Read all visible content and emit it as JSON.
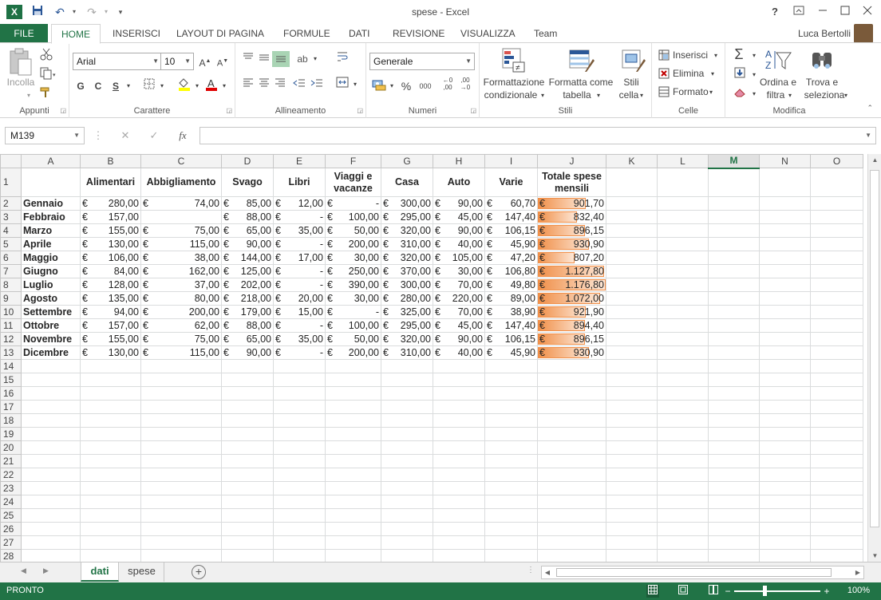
{
  "window": {
    "title": "spese - Excel",
    "help": "?",
    "user_name": "Luca Bertolli"
  },
  "quick_access": {
    "save": "💾",
    "undo": "↶",
    "redo": "↷",
    "customize": "▾"
  },
  "ribbon_tabs": {
    "file": "FILE",
    "home": "HOME",
    "insert": "INSERISCI",
    "page_layout": "LAYOUT DI PAGINA",
    "formulas": "FORMULE",
    "data": "DATI",
    "review": "REVISIONE",
    "view": "VISUALIZZA",
    "team": "Team"
  },
  "ribbon": {
    "clipboard": {
      "paste": "Incolla",
      "group": "Appunti"
    },
    "font": {
      "name": "Arial",
      "size": "10",
      "bold": "G",
      "italic": "C",
      "underline": "S",
      "group": "Carattere"
    },
    "alignment": {
      "group": "Allineamento"
    },
    "number": {
      "format": "Generale",
      "percent": "%",
      "thousands": "000",
      "group": "Numeri"
    },
    "styles": {
      "cond_format_1": "Formattazione",
      "cond_format_2": "condizionale",
      "table_format_1": "Formatta come",
      "table_format_2": "tabella",
      "cell_styles_1": "Stili",
      "cell_styles_2": "cella",
      "group": "Stili"
    },
    "cells": {
      "insert": "Inserisci",
      "delete": "Elimina",
      "format": "Formato",
      "group": "Celle"
    },
    "editing": {
      "sort_1": "Ordina e",
      "sort_2": "filtra",
      "find_1": "Trova e",
      "find_2": "seleziona",
      "group": "Modifica"
    }
  },
  "formula_bar": {
    "name_box": "M139",
    "cancel": "✕",
    "confirm": "✓",
    "fx": "fx",
    "formula": ""
  },
  "sheet": {
    "columns": [
      "A",
      "B",
      "C",
      "D",
      "E",
      "F",
      "G",
      "H",
      "I",
      "J",
      "K",
      "L",
      "M",
      "N",
      "O"
    ],
    "selected_column": "M",
    "row_numbers": [
      "1",
      "2",
      "3",
      "4",
      "5",
      "6",
      "7",
      "8",
      "9",
      "10",
      "11",
      "12",
      "13",
      "14",
      "15",
      "16",
      "17",
      "18",
      "19",
      "20",
      "21",
      "22",
      "23",
      "24",
      "25",
      "26",
      "27",
      "28"
    ],
    "headers": [
      "Alimentari",
      "Abbigliamento",
      "Svago",
      "Libri",
      "Viaggi e vacanze",
      "Casa",
      "Auto",
      "Varie",
      "Totale spese mensili"
    ],
    "currency": "€",
    "rows": [
      {
        "month": "Gennaio",
        "values": [
          "280,00",
          "74,00",
          "85,00",
          "12,00",
          "-",
          "300,00",
          "90,00",
          "60,70"
        ],
        "total": "901,70",
        "fill": 0.7
      },
      {
        "month": "Febbraio",
        "values": [
          "157,00",
          "",
          "88,00",
          "-",
          "100,00",
          "295,00",
          "45,00",
          "147,40"
        ],
        "total": "832,40",
        "fill": 0.58
      },
      {
        "month": "Marzo",
        "values": [
          "155,00",
          "75,00",
          "65,00",
          "35,00",
          "50,00",
          "320,00",
          "90,00",
          "106,15"
        ],
        "total": "896,15",
        "fill": 0.69
      },
      {
        "month": "Aprile",
        "values": [
          "130,00",
          "115,00",
          "90,00",
          "-",
          "200,00",
          "310,00",
          "40,00",
          "45,90"
        ],
        "total": "930,90",
        "fill": 0.75
      },
      {
        "month": "Maggio",
        "values": [
          "106,00",
          "38,00",
          "144,00",
          "17,00",
          "30,00",
          "320,00",
          "105,00",
          "47,20"
        ],
        "total": "807,20",
        "fill": 0.54
      },
      {
        "month": "Giugno",
        "values": [
          "84,00",
          "162,00",
          "125,00",
          "-",
          "250,00",
          "370,00",
          "30,00",
          "106,80"
        ],
        "total": "1.127,80",
        "fill": 0.98
      },
      {
        "month": "Luglio",
        "values": [
          "128,00",
          "37,00",
          "202,00",
          "-",
          "390,00",
          "300,00",
          "70,00",
          "49,80"
        ],
        "total": "1.176,80",
        "fill": 1.0
      },
      {
        "month": "Agosto",
        "values": [
          "135,00",
          "80,00",
          "218,00",
          "20,00",
          "30,00",
          "280,00",
          "220,00",
          "89,00"
        ],
        "total": "1.072,00",
        "fill": 0.92
      },
      {
        "month": "Settembre",
        "values": [
          "94,00",
          "200,00",
          "179,00",
          "15,00",
          "-",
          "325,00",
          "70,00",
          "38,90"
        ],
        "total": "921,90",
        "fill": 0.71
      },
      {
        "month": "Ottobre",
        "values": [
          "157,00",
          "62,00",
          "88,00",
          "-",
          "100,00",
          "295,00",
          "45,00",
          "147,40"
        ],
        "total": "894,40",
        "fill": 0.69
      },
      {
        "month": "Novembre",
        "values": [
          "155,00",
          "75,00",
          "65,00",
          "35,00",
          "50,00",
          "320,00",
          "90,00",
          "106,15"
        ],
        "total": "896,15",
        "fill": 0.69
      },
      {
        "month": "Dicembre",
        "values": [
          "130,00",
          "115,00",
          "90,00",
          "-",
          "200,00",
          "310,00",
          "40,00",
          "45,90"
        ],
        "total": "930,90",
        "fill": 0.75
      }
    ]
  },
  "sheet_tabs": {
    "tabs": [
      {
        "label": "dati",
        "active": true
      },
      {
        "label": "spese",
        "active": false
      }
    ],
    "add": "+"
  },
  "status_bar": {
    "status": "PRONTO",
    "zoom_minus": "−",
    "zoom_plus": "+",
    "zoom": "100%"
  },
  "colors": {
    "accent": "#217346",
    "databar": "#f0904a"
  }
}
